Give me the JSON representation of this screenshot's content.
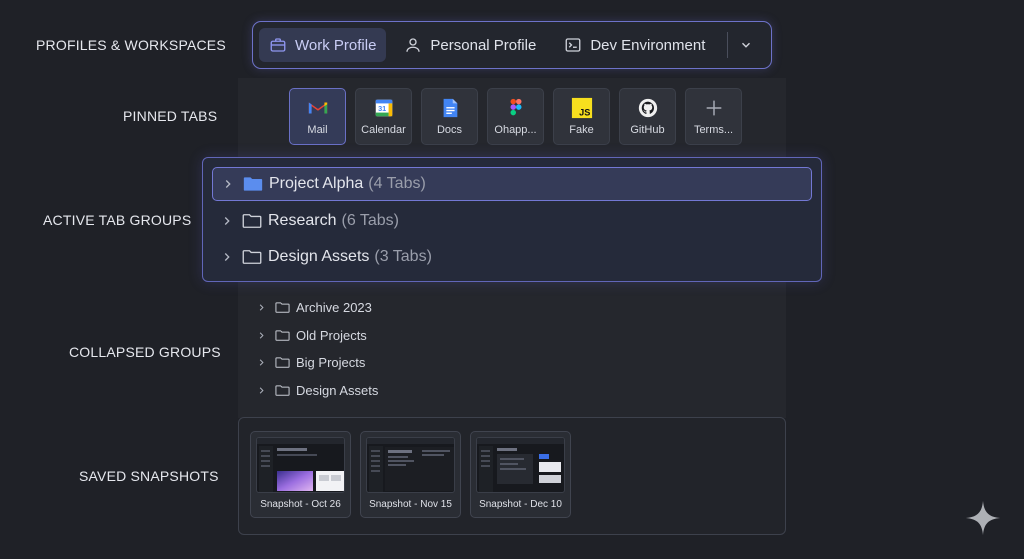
{
  "sections": {
    "profiles": "PROFILES & WORKSPACES",
    "pinned": "PINNED TABS",
    "active_groups": "ACTIVE TAB GROUPS",
    "collapsed": "COLLAPSED GROUPS",
    "snapshots": "SAVED SNAPSHOTS"
  },
  "profiles": {
    "items": [
      {
        "label": "Work Profile",
        "icon": "briefcase-icon",
        "active": true
      },
      {
        "label": "Personal Profile",
        "icon": "person-icon",
        "active": false
      },
      {
        "label": "Dev Environment",
        "icon": "terminal-icon",
        "active": false
      }
    ],
    "more_icon": "chevron-down-icon"
  },
  "pinned_tabs": [
    {
      "label": "Mail",
      "icon": "gmail-icon",
      "active": true
    },
    {
      "label": "Calendar",
      "icon": "calendar-icon",
      "badge": "31"
    },
    {
      "label": "Docs",
      "icon": "docs-icon"
    },
    {
      "label": "Ohapp...",
      "icon": "figma-icon"
    },
    {
      "label": "Fake",
      "icon": "js-icon",
      "badge": "JS"
    },
    {
      "label": "GitHub",
      "icon": "github-icon"
    },
    {
      "label": "Terms...",
      "icon": "plus-icon"
    }
  ],
  "active_groups": [
    {
      "name": "Project Alpha",
      "count": "(4 Tabs)",
      "active": true
    },
    {
      "name": "Research",
      "count": "(6 Tabs)",
      "active": false
    },
    {
      "name": "Design Assets",
      "count": "(3 Tabs)",
      "active": false
    }
  ],
  "collapsed_groups": [
    {
      "name": "Archive 2023"
    },
    {
      "name": "Old Projects"
    },
    {
      "name": "Big Projects"
    },
    {
      "name": "Design Assets"
    }
  ],
  "snapshots": [
    {
      "label": "Snapshot - Oct 26"
    },
    {
      "label": "Snapshot - Nov 15"
    },
    {
      "label": "Snapshot - Dec 10"
    }
  ],
  "colors": {
    "accent": "#6d72c9",
    "background": "#1f2127",
    "folder_active": "#5b8dee"
  }
}
